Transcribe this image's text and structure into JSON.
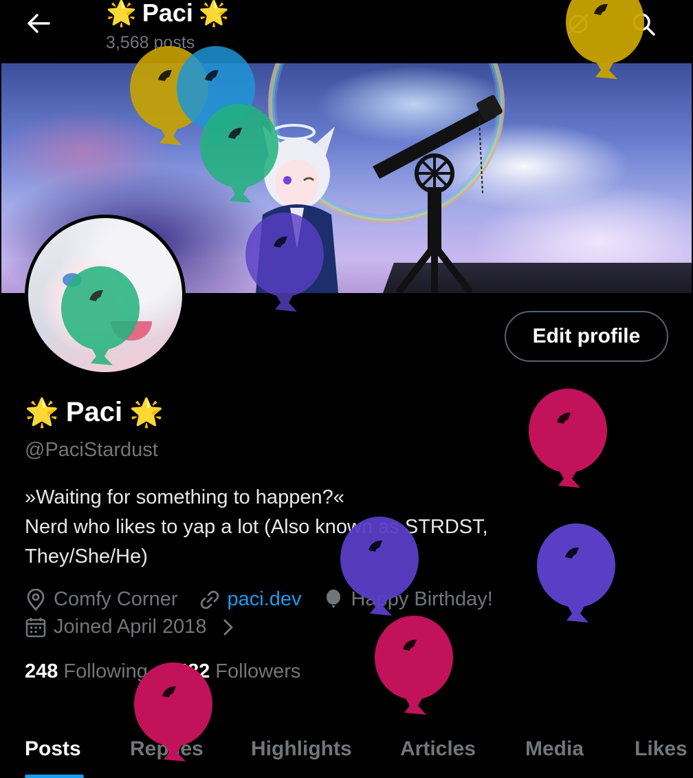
{
  "header": {
    "title": "Paci",
    "title_emoji_left": "🌟",
    "title_emoji_right": "🌟",
    "post_count": "3,568 posts"
  },
  "icons": {
    "back": "arrow-left-icon",
    "grok": "grok-icon",
    "search": "search-icon",
    "location": "location-pin-icon",
    "link": "link-icon",
    "birthday": "balloon-icon",
    "calendar": "calendar-icon",
    "chevron": "chevron-right-icon"
  },
  "profile": {
    "edit_button": "Edit profile",
    "name": "Paci",
    "name_emoji_left": "🌟",
    "name_emoji_right": "🌟",
    "handle": "@PaciStardust",
    "bio_lines": [
      "»Waiting for something to happen?«",
      "Nerd who likes to yap a lot (Also known as STRDST,",
      "They/She/He)"
    ],
    "location": "Comfy Corner",
    "website": "paci.dev",
    "birthday": "Happy Birthday!",
    "joined": "Joined April 2018",
    "following_count": "248",
    "following_label": "Following",
    "followers_count": "482",
    "followers_label": "Followers"
  },
  "tabs": [
    {
      "label": "Posts",
      "active": true
    },
    {
      "label": "Replies",
      "active": false
    },
    {
      "label": "Highlights",
      "active": false
    },
    {
      "label": "Articles",
      "active": false
    },
    {
      "label": "Media",
      "active": false
    },
    {
      "label": "Likes",
      "active": false
    }
  ],
  "colors": {
    "background": "#000000",
    "accent": "#1d9bf0",
    "muted_text": "#71767b",
    "balloon_yellow": "#c9a400",
    "balloon_blue": "#1f95d6",
    "balloon_green": "#22b37d",
    "balloon_purple": "#5a3fc6",
    "balloon_magenta": "#c2125a"
  }
}
